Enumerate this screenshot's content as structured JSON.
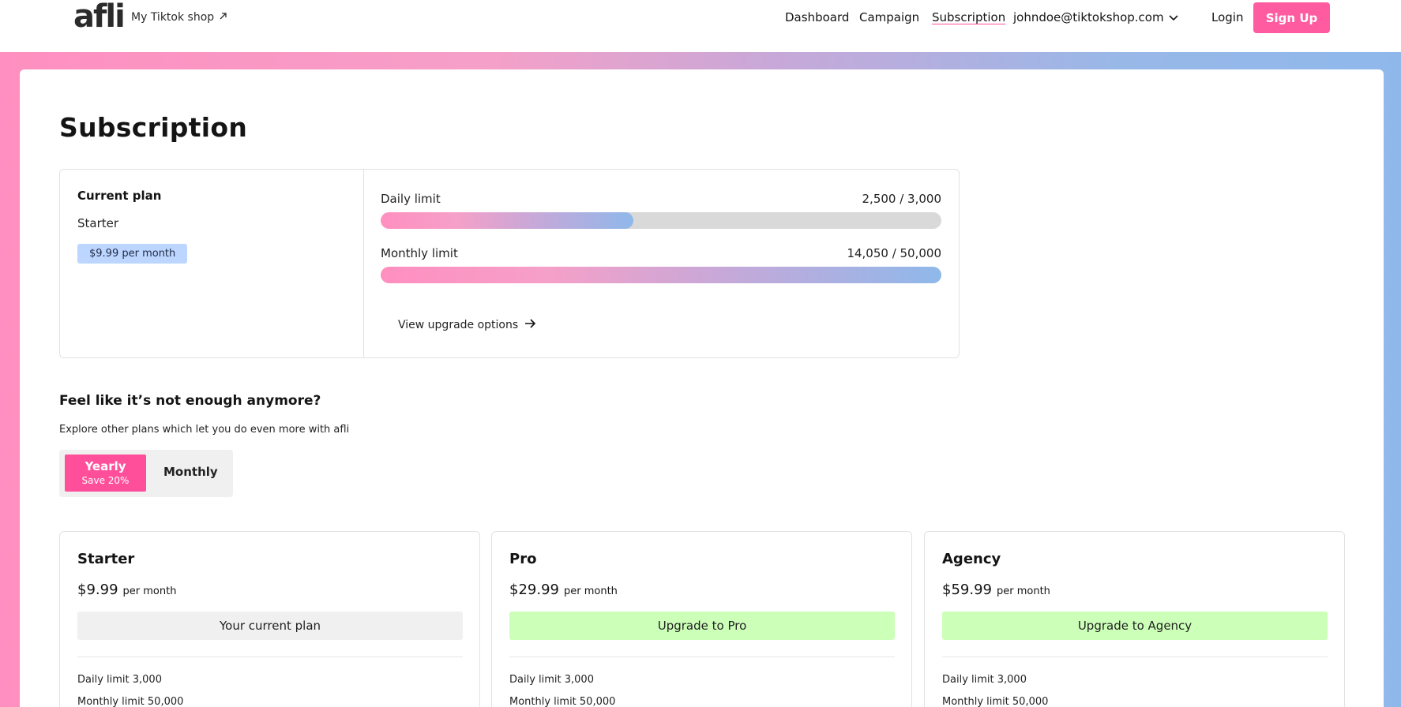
{
  "header": {
    "logo_text": "afli",
    "shop_link": "My Tiktok shop",
    "nav": {
      "dashboard": "Dashboard",
      "campaign": "Campaign",
      "subscription": "Subscription",
      "account": "johndoe@tiktokshop.com"
    },
    "login": "Login",
    "signup": "Sign Up"
  },
  "page": {
    "title": "Subscription"
  },
  "current_plan": {
    "label": "Current plan",
    "name": "Starter",
    "price": "$9.99 per month",
    "daily_limit": {
      "label": "Daily limit",
      "value": "2,500 / 3,000",
      "fill_percent": 45
    },
    "monthly_limit": {
      "label": "Monthly limit",
      "value": "14,050 / 50,000",
      "fill_percent": 100
    },
    "upgrade_link": "View upgrade options"
  },
  "explore": {
    "title": "Feel like it’s not enough anymore?",
    "subtitle": "Explore other plans which let you do even more with afli",
    "toggle": {
      "yearly": "Yearly",
      "yearly_note": "Save 20%",
      "monthly": "Monthly",
      "selected": "Yearly"
    }
  },
  "plans": [
    {
      "name": "Starter",
      "price": "$9.99",
      "period": "per month",
      "button": "Your current plan",
      "features": [
        "Daily limit 3,000",
        "Monthly limit 50,000"
      ]
    },
    {
      "name": "Pro",
      "price": "$29.99",
      "period": "per month",
      "button": "Upgrade to Pro",
      "features": [
        "Daily limit 3,000",
        "Monthly limit 50,000"
      ]
    },
    {
      "name": "Agency",
      "price": "$59.99",
      "period": "per month",
      "button": "Upgrade to Agency",
      "features": [
        "Daily limit 3,000",
        "Monthly limit 50,000"
      ]
    }
  ],
  "colors": {
    "accent_pink": "#ff5ba0",
    "price_badge": "#bcd6ff",
    "upgrade_green": "#ccffb8"
  },
  "icons": {
    "shop_link": "external-arrow-icon",
    "account": "chevron-down-icon",
    "upgrade": "arrow-right-icon"
  }
}
